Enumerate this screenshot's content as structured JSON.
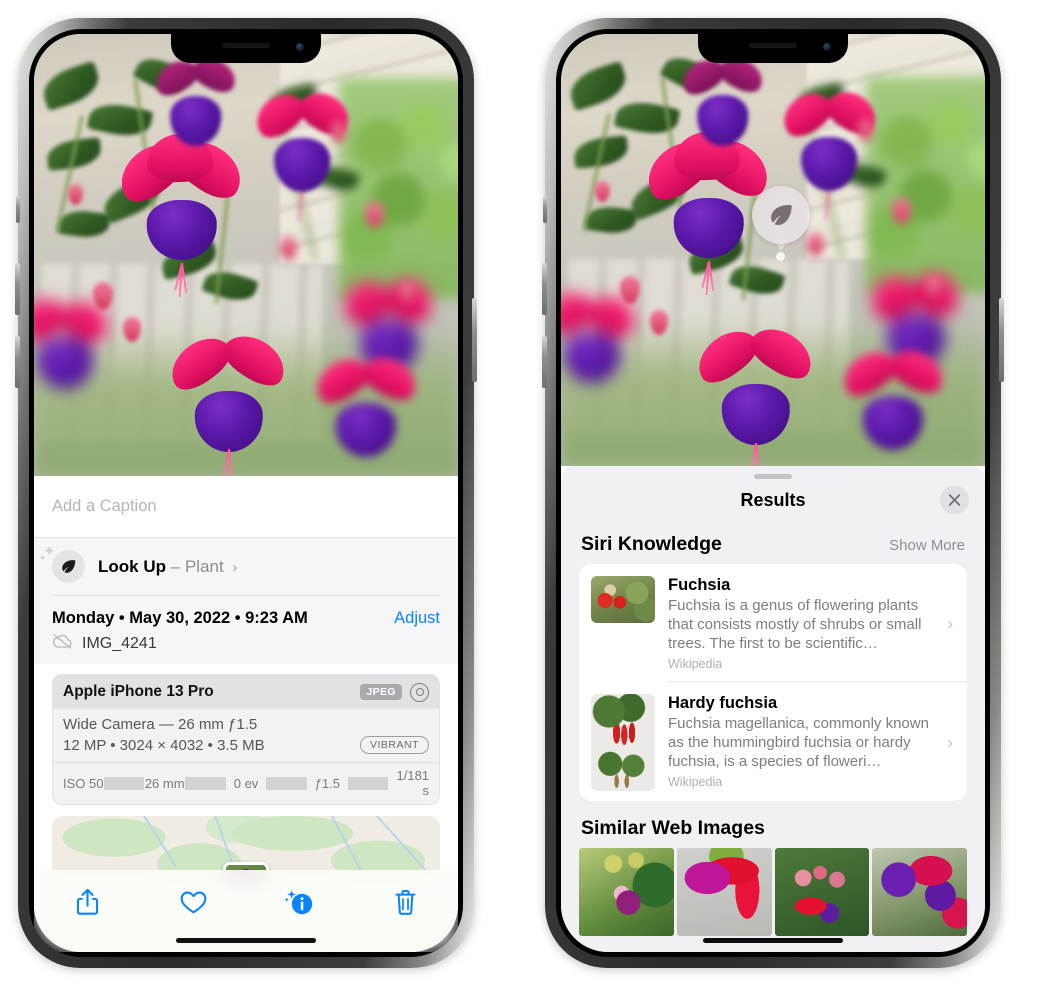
{
  "left_phone": {
    "photo_alt": "fuchsia-flowers-photo",
    "caption_placeholder": "Add a Caption",
    "caption_value": "",
    "lookup": {
      "icon": "leaf-icon",
      "label": "Look Up",
      "separator": "–",
      "kind": "Plant",
      "chevron": "›"
    },
    "meta": {
      "date_line": "Monday • May 30, 2022 • 9:23 AM",
      "adjust_label": "Adjust",
      "cloud_icon": "icloud-slash-icon",
      "filename": "IMG_4241"
    },
    "exif": {
      "model": "Apple iPhone 13 Pro",
      "format_badge": "JPEG",
      "aperture_icon": "aperture-icon",
      "lens_line": "Wide Camera — 26 mm ƒ1.5",
      "size_line": "12 MP • 3024 × 4032 • 3.5 MB",
      "style_badge": "VIBRANT",
      "stats": [
        "ISO 50",
        "26 mm",
        "0 ev",
        "ƒ1.5",
        "1/181 s"
      ]
    },
    "toolbar": [
      {
        "name": "share-icon",
        "label": "Share"
      },
      {
        "name": "heart-icon",
        "label": "Favorite"
      },
      {
        "name": "info-sparkle-icon",
        "label": "Info"
      },
      {
        "name": "trash-icon",
        "label": "Delete"
      }
    ],
    "accent_color": "#0a84ff"
  },
  "right_phone": {
    "visual_lookup_badge": {
      "icon": "leaf-icon",
      "label": "Visual Look Up"
    },
    "results": {
      "title": "Results",
      "close_icon": "close-icon",
      "siri_knowledge": {
        "title": "Siri Knowledge",
        "action": "Show More",
        "items": [
          {
            "thumb": "fuchsia-thumbnail",
            "title": "Fuchsia",
            "description": "Fuchsia is a genus of flowering plants that consists mostly of shrubs or small trees. The first to be scientific…",
            "source": "Wikipedia",
            "chevron": "›"
          },
          {
            "thumb": "hardy-fuchsia-thumbnail",
            "title": "Hardy fuchsia",
            "description": "Fuchsia magellanica, commonly known as the hummingbird fuchsia or hardy fuchsia, is a species of floweri…",
            "source": "Wikipedia",
            "chevron": "›"
          }
        ]
      },
      "similar_web_images": {
        "title": "Similar Web Images",
        "items": [
          {
            "name": "web-image-1"
          },
          {
            "name": "web-image-2"
          },
          {
            "name": "web-image-3"
          },
          {
            "name": "web-image-4"
          }
        ]
      }
    }
  }
}
